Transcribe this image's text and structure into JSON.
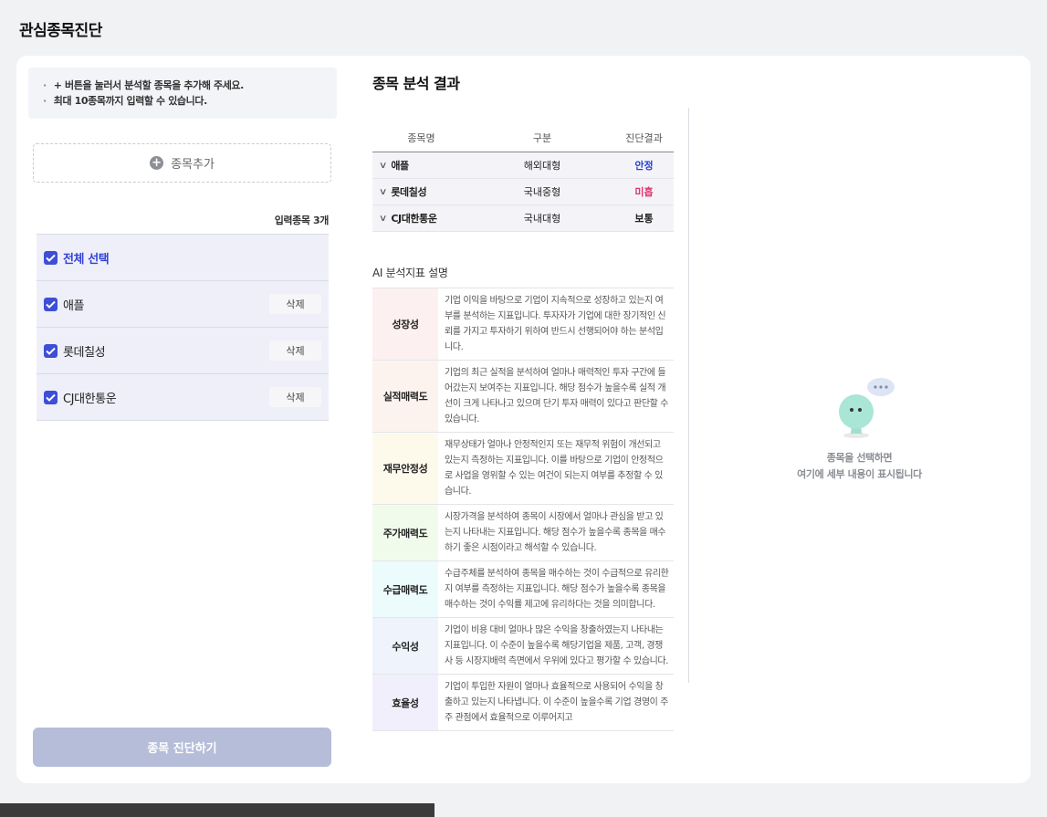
{
  "page_title": "관심종목진단",
  "notice": [
    "+ 버튼을 눌러서 분석할 종목을 추가해 주세요.",
    "최대 10종목까지 입력할 수 있습니다."
  ],
  "add_button_label": "종목추가",
  "input_count_label": "입력종목 3개",
  "select_all_label": "전체 선택",
  "stocks": [
    {
      "name": "애플",
      "delete_label": "삭제"
    },
    {
      "name": "롯데칠성",
      "delete_label": "삭제"
    },
    {
      "name": "CJ대한통운",
      "delete_label": "삭제"
    }
  ],
  "diagnose_button_label": "종목 진단하기",
  "result_title": "종목 분석 결과",
  "results_table": {
    "headers": [
      "종목명",
      "구분",
      "진단결과"
    ],
    "rows": [
      {
        "name": "애플",
        "category": "해외대형",
        "result": "안정",
        "result_color": "#2a3fd6"
      },
      {
        "name": "롯데칠성",
        "category": "국내중형",
        "result": "미흡",
        "result_color": "#e0356b"
      },
      {
        "name": "CJ대한통운",
        "category": "국내대형",
        "result": "보통",
        "result_color": "#222222"
      }
    ]
  },
  "ai_section_title": "AI 분석지표 설명",
  "indicators": [
    {
      "name": "성장성",
      "bg": "#fdf0f0",
      "desc": "기업 이익을 바탕으로 기업이 지속적으로 성장하고 있는지 여부를 분석하는 지표입니다. 투자자가 기업에 대한 장기적인 신뢰를 가지고 투자하기 위하여 반드시 선행되어야 하는 분석입니다."
    },
    {
      "name": "실적매력도",
      "bg": "#fdf3ee",
      "desc": "기업의 최근 실적을 분석하여 얼마나 매력적인 투자 구간에 들어갔는지 보여주는 지표입니다. 해당 점수가 높을수록 실적 개선이 크게 나타나고 있으며 단기 투자 매력이 있다고 판단할 수 있습니다."
    },
    {
      "name": "재무안정성",
      "bg": "#fdfaec",
      "desc": "재무상태가 얼마나 안정적인지 또는 재무적 위험이 개선되고 있는지 측정하는 지표입니다. 이를 바탕으로 기업이 안정적으로 사업을 영위할 수 있는 여건이 되는지 여부를 추정할 수 있습니다."
    },
    {
      "name": "주가매력도",
      "bg": "#f1fbec",
      "desc": "시장가격을 분석하여 종목이 시장에서 얼마나 관심을 받고 있는지 나타내는 지표입니다. 해당 점수가 높을수록 종목을 매수하기 좋은 시점이라고 해석할 수 있습니다."
    },
    {
      "name": "수급매력도",
      "bg": "#ecfbfb",
      "desc": "수급주체를 분석하여 종목을 매수하는 것이 수급적으로 유리한지 여부를 측정하는 지표입니다. 해당 점수가 높을수록 종목을 매수하는 것이 수익률 제고에 유리하다는 것을 의미합니다."
    },
    {
      "name": "수익성",
      "bg": "#eef3fc",
      "desc": "기업이 비용 대비 얼마나 많은 수익을 창출하였는지 나타내는 지표입니다. 이 수준이 높을수록 해당기업을 제품, 고객, 경쟁사 등 시장지배력 측면에서 우위에 있다고 평가할 수 있습니다."
    },
    {
      "name": "효율성",
      "bg": "#f1effc",
      "desc": "기업이 투입한 자원이 얼마나 효율적으로 사용되어 수익을 창출하고 있는지 나타냅니다. 이 수준이 높을수록 기업 경영이 주주 관점에서 효율적으로 이루어지고"
    }
  ],
  "empty_state": {
    "line1": "종목을 선택하면",
    "line2": "여기에 세부 내용이 표시됩니다"
  },
  "colors": {
    "accent": "#3d4fd6",
    "disabled_button": "#b5bdd9"
  }
}
